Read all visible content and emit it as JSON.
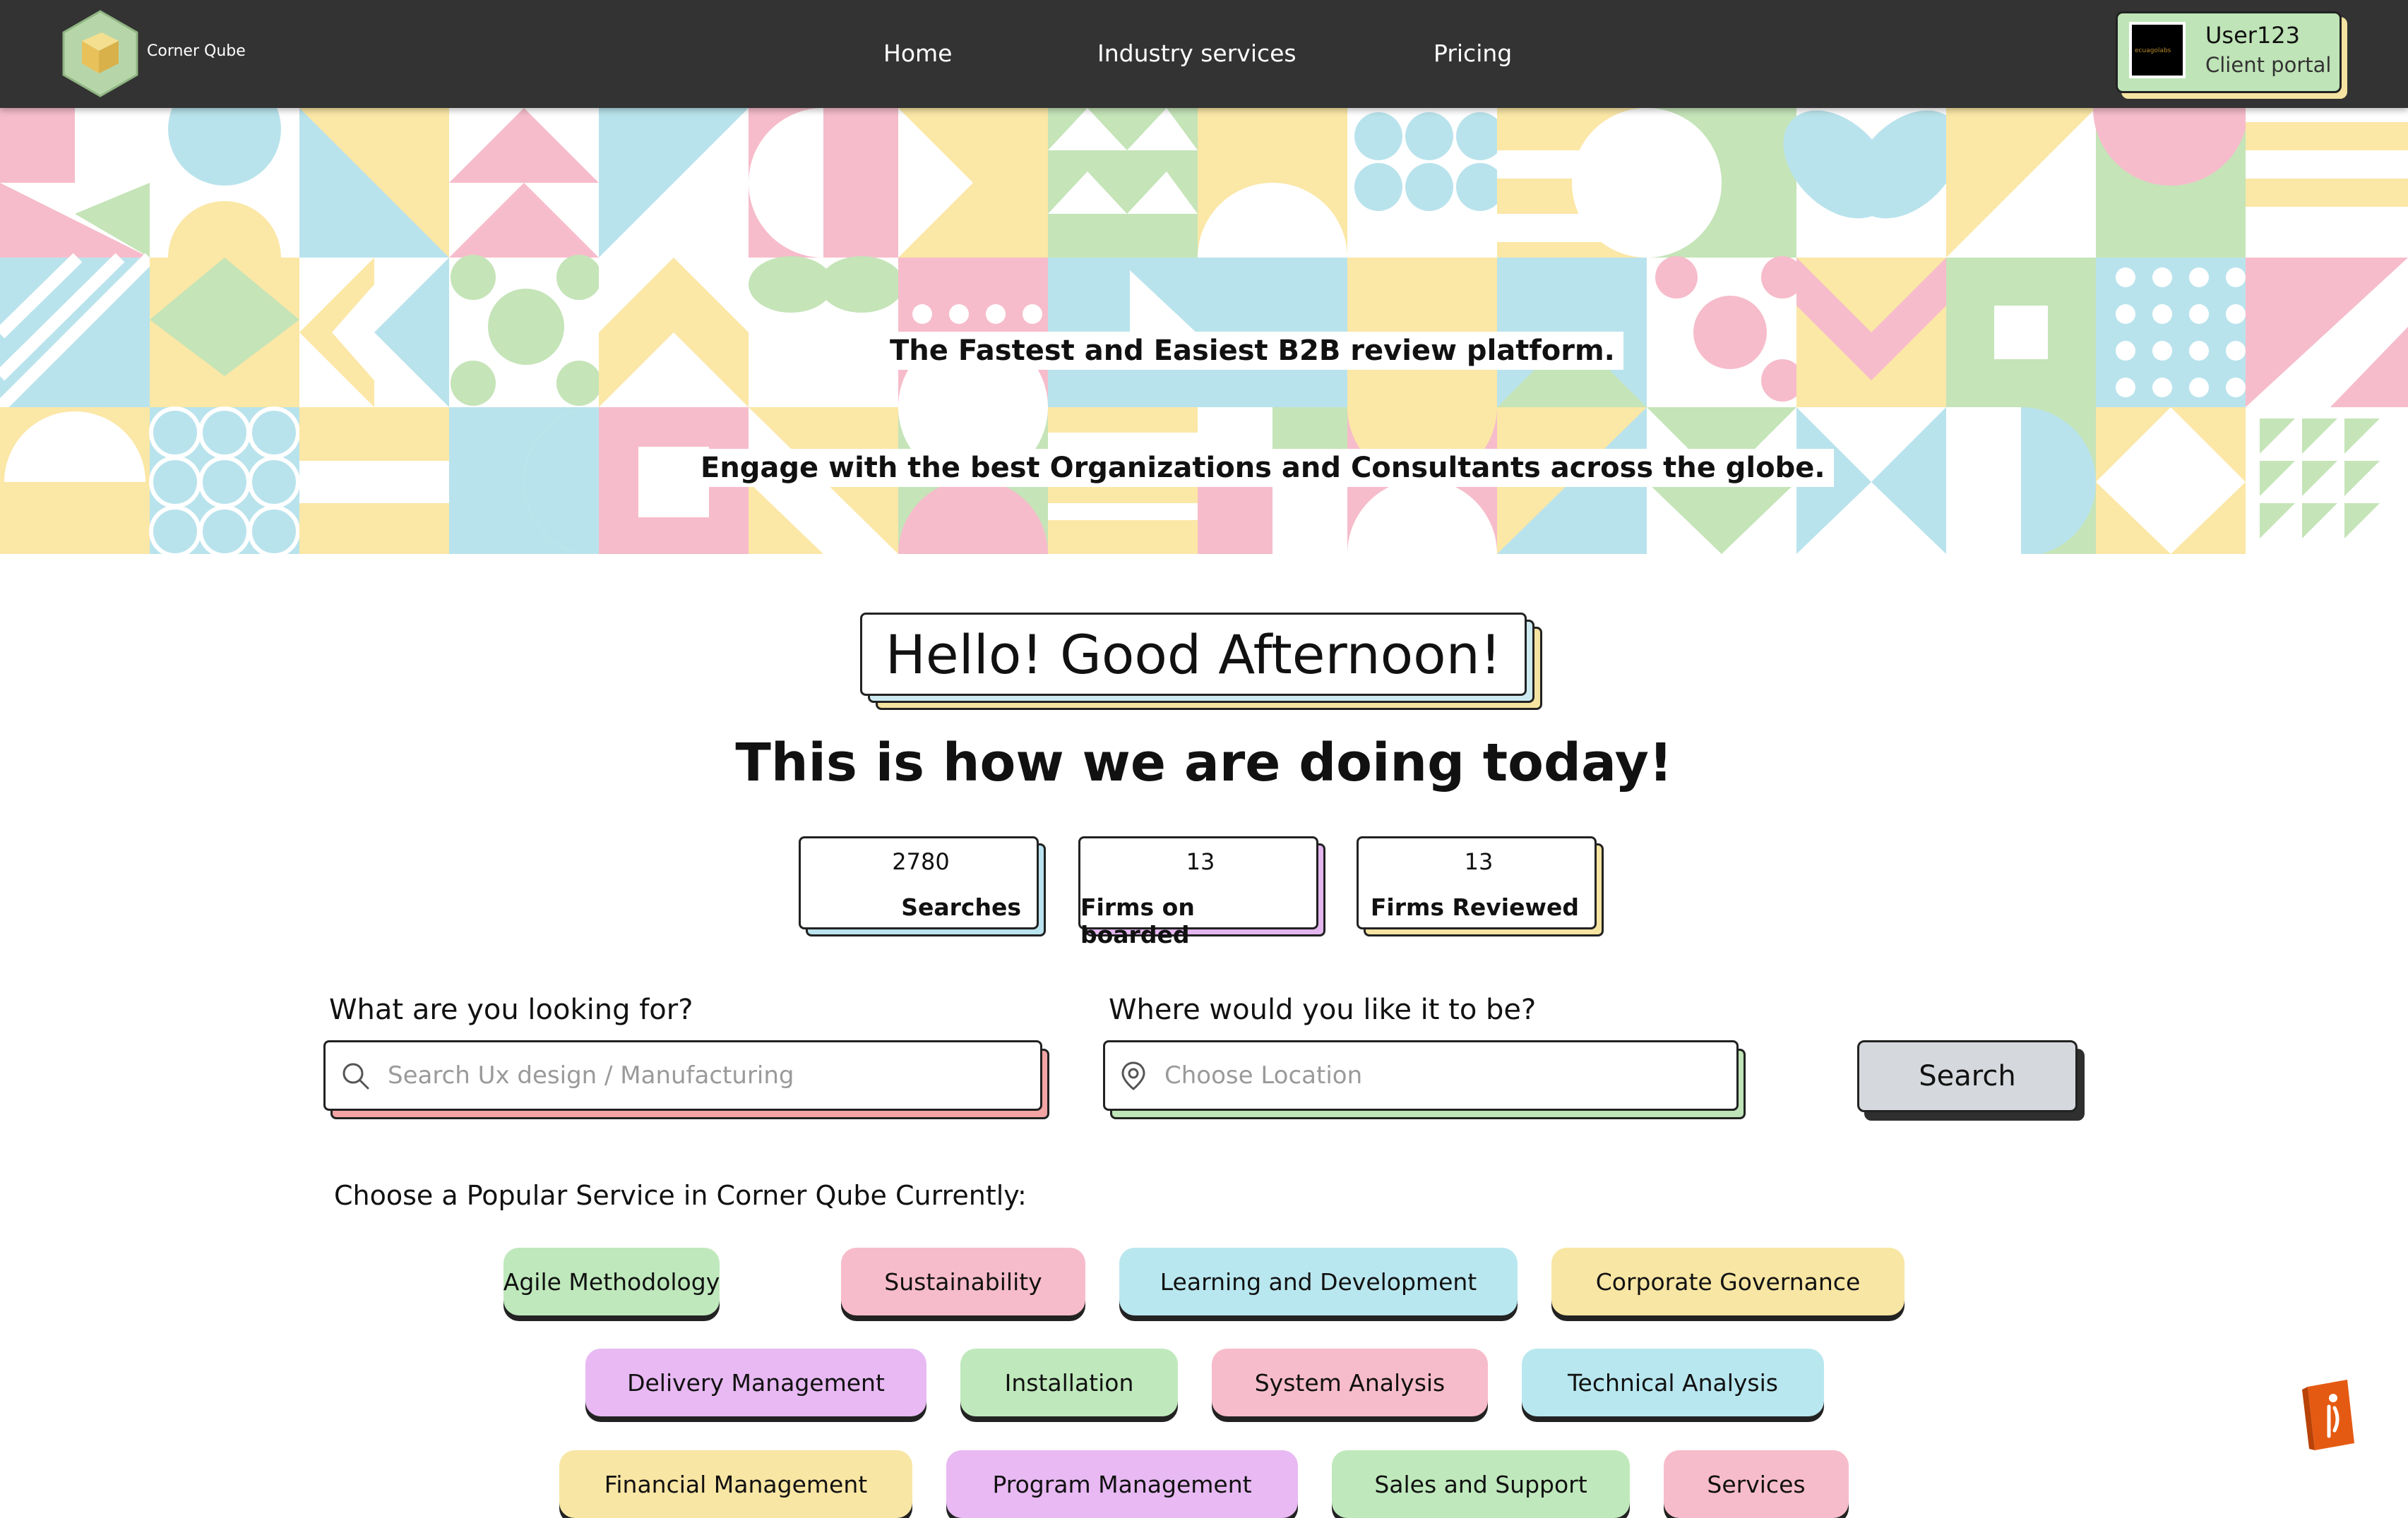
{
  "header": {
    "brand": "Corner Qube",
    "nav": [
      "Home",
      "Industry services",
      "Pricing"
    ],
    "user": {
      "name": "User123",
      "role": "Client portal",
      "avatar_text": "ecuagolabs"
    }
  },
  "hero": {
    "tagline": "The Fastest and Easiest B2B review platform.",
    "subtagline": "Engage with the best Organizations and Consultants across the globe."
  },
  "greeting": "Hello! Good Afternoon!",
  "status_heading": "This is how we are doing today!",
  "stats": [
    {
      "value": "2780",
      "label": "Searches",
      "accent": "#b9e3ee"
    },
    {
      "value": "13",
      "label": "Firms on boarded",
      "accent": "#e3b6ef"
    },
    {
      "value": "13",
      "label": "Firms Reviewed",
      "accent": "#f5e3a2"
    }
  ],
  "search": {
    "what_label": "What are you looking for?",
    "what_placeholder": "Search Ux design / Manufacturing",
    "where_label": "Where would you like it to be?",
    "where_placeholder": "Choose Location",
    "button_label": "Search"
  },
  "popular": {
    "label": "Choose a Popular Service in Corner Qube Currently:",
    "services": [
      {
        "name": "Agile Methodology",
        "color": "#bfe9bc"
      },
      {
        "name": "Sustainability",
        "color": "#f7bccb"
      },
      {
        "name": "Learning and Development",
        "color": "#b9e7ef"
      },
      {
        "name": "Corporate Governance",
        "color": "#f8e6a4"
      },
      {
        "name": "Delivery Management",
        "color": "#e8b9f3"
      },
      {
        "name": "Installation",
        "color": "#bfe9bc"
      },
      {
        "name": "System Analysis",
        "color": "#f7bccb"
      },
      {
        "name": "Technical Analysis",
        "color": "#b9e7ef"
      },
      {
        "name": "Financial Management",
        "color": "#f8e6a4"
      },
      {
        "name": "Program Management",
        "color": "#e8b9f3"
      },
      {
        "name": "Sales and Support",
        "color": "#bfe9bc"
      },
      {
        "name": "Services",
        "color": "#f7bccb"
      }
    ]
  },
  "theme": {
    "topbar": "#333333",
    "pink": "#f6bccb",
    "blue": "#b9e3ec",
    "yellow": "#fbe7a6",
    "green": "#c5e4b8",
    "coral": "#f4a4a4"
  }
}
